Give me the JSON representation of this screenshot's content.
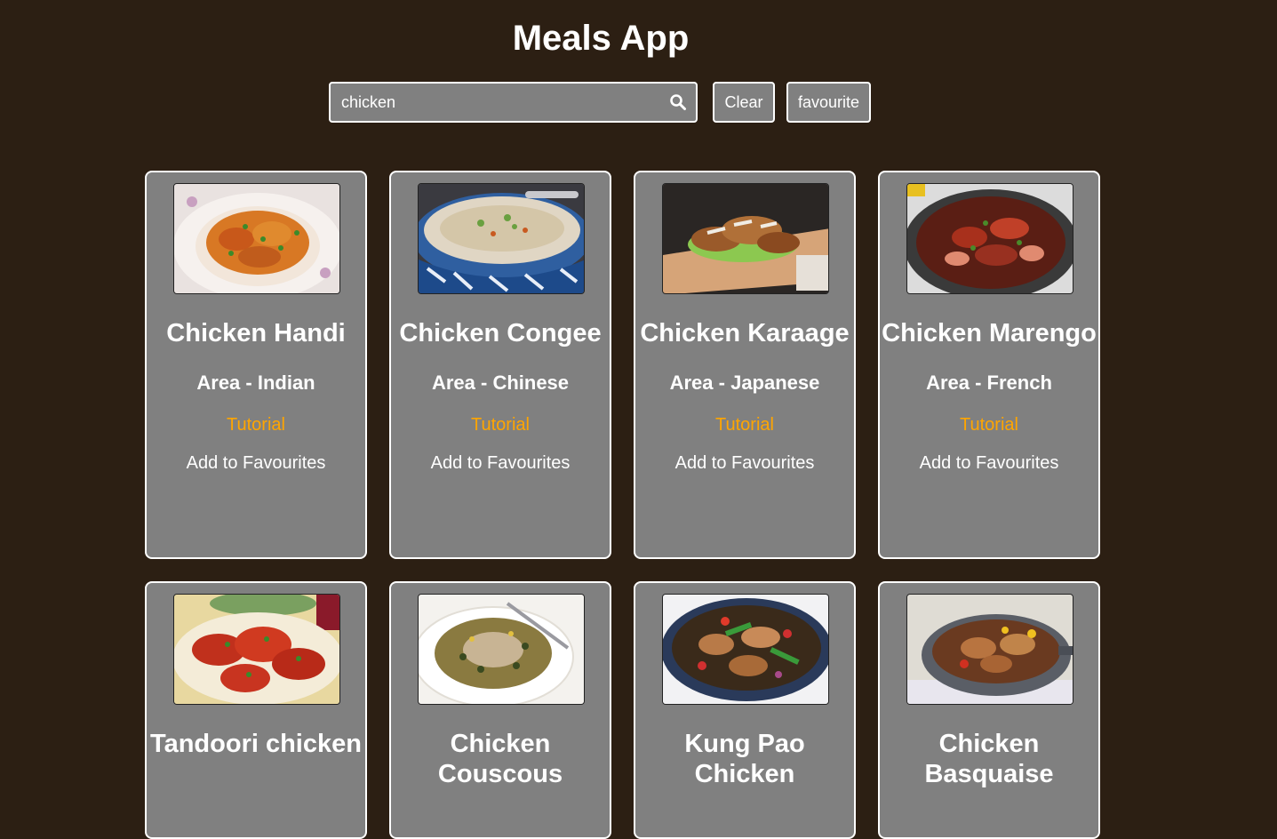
{
  "app": {
    "title": "Meals App"
  },
  "search": {
    "value": "chicken",
    "icon": "search-icon"
  },
  "buttons": {
    "clear": "Clear",
    "favourite": "favourite"
  },
  "meals": [
    {
      "name": "Chicken Handi",
      "area": "Area - Indian",
      "tutorial": "Tutorial",
      "favourite": "Add to Favourites",
      "image": "chicken-handi-photo"
    },
    {
      "name": "Chicken Congee",
      "area": "Area - Chinese",
      "tutorial": "Tutorial",
      "favourite": "Add to Favourites",
      "image": "chicken-congee-photo"
    },
    {
      "name": "Chicken Karaage",
      "area": "Area - Japanese",
      "tutorial": "Tutorial",
      "favourite": "Add to Favourites",
      "image": "chicken-karaage-photo"
    },
    {
      "name": "Chicken Marengo",
      "area": "Area - French",
      "tutorial": "Tutorial",
      "favourite": "Add to Favourites",
      "image": "chicken-marengo-photo"
    },
    {
      "name": "Tandoori chicken",
      "image": "tandoori-chicken-photo"
    },
    {
      "name": "Chicken Couscous",
      "image": "chicken-couscous-photo"
    },
    {
      "name": "Kung Pao Chicken",
      "image": "kung-pao-chicken-photo"
    },
    {
      "name": "Chicken Basquaise",
      "image": "chicken-basquaise-photo"
    }
  ],
  "colors": {
    "background": "#2c1f13",
    "card": "#808080",
    "accent": "#ffa500",
    "text": "#ffffff"
  }
}
